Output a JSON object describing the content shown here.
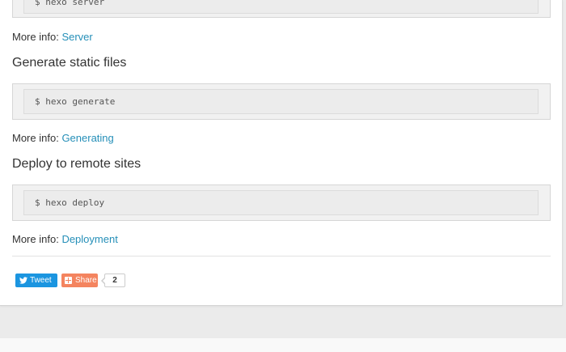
{
  "sections": [
    {
      "command": "$ hexo server",
      "more_info_label": "More info:",
      "link_text": "Server"
    },
    {
      "heading": "Generate static files",
      "command": "$ hexo generate",
      "more_info_label": "More info:",
      "link_text": "Generating"
    },
    {
      "heading": "Deploy to remote sites",
      "command": "$ hexo deploy",
      "more_info_label": "More info:",
      "link_text": "Deployment"
    }
  ],
  "share_bar": {
    "tweet_label": "Tweet",
    "share_label": "Share",
    "share_count": "2"
  },
  "colors": {
    "link": "#258fb8",
    "tweet_button": "#1b95e0",
    "share_button": "#f4845f"
  },
  "icons": {
    "tweet": "twitter-bird-icon",
    "share": "plus-box-icon"
  }
}
